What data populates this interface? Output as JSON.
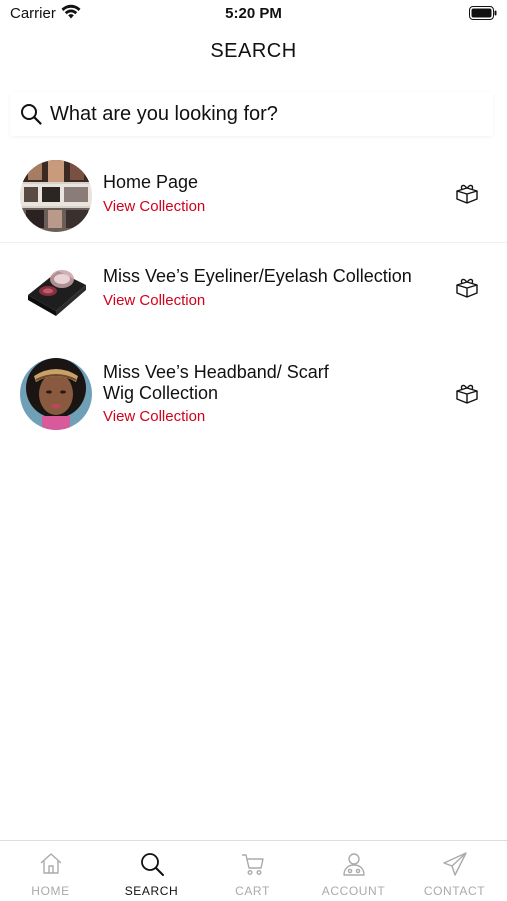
{
  "status_bar": {
    "carrier": "Carrier",
    "time": "5:20 PM"
  },
  "header": {
    "title": "SEARCH"
  },
  "search": {
    "placeholder": "What are you looking for?"
  },
  "collections": [
    {
      "title": "Home Page",
      "link": "View Collection",
      "icon": "gift-box-icon"
    },
    {
      "title": "Miss Vee’s Eyeliner/Eyelash Collection",
      "link": "View Collection",
      "icon": "gift-box-icon"
    },
    {
      "title_line1": "Miss Vee’s Headband/ Scarf",
      "title_line2": "Wig Collection",
      "link": "View Collection",
      "icon": "gift-box-icon"
    }
  ],
  "tabs": [
    {
      "label": "HOME",
      "icon": "home-icon",
      "active": false
    },
    {
      "label": "SEARCH",
      "icon": "search-icon",
      "active": true
    },
    {
      "label": "CART",
      "icon": "cart-icon",
      "active": false
    },
    {
      "label": "ACCOUNT",
      "icon": "account-icon",
      "active": false
    },
    {
      "label": "CONTACT",
      "icon": "send-icon",
      "active": false
    }
  ],
  "colors": {
    "link": "#d0021b",
    "active_tab": "#111111",
    "inactive_tab": "#aaaaaa"
  }
}
